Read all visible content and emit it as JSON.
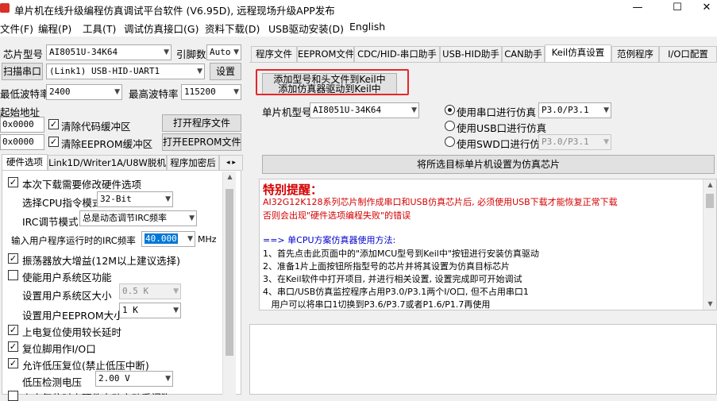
{
  "window": {
    "title": "单片机在线升级编程仿真调试平台软件 (V6.95D), 远程现场升级APP发布",
    "minimize": "—",
    "maximize": "☐",
    "close": "✕"
  },
  "menu": [
    "文件(F)",
    "编程(P)",
    "工具(T)",
    "调试仿真接口(G)",
    "资料下载(D)",
    "USB驱动安装(D)",
    "English"
  ],
  "left": {
    "chip_model_label": "芯片型号",
    "chip_model_value": "AI8051U-34K64",
    "pin_count_label": "引脚数",
    "pin_count_value": "Auto",
    "scan_port_button": "扫描串口",
    "port_value": "(Link1) USB-HID-UART1",
    "settings_button": "设置",
    "min_baud_label": "最低波特率",
    "min_baud_value": "2400",
    "max_baud_label": "最高波特率",
    "max_baud_value": "115200",
    "start_addr_label": "起始地址",
    "addr1_value": "0x0000",
    "clear_code_buffer": "清除代码缓冲区",
    "open_program_button": "打开程序文件",
    "addr2_value": "0x0000",
    "clear_eeprom_buffer": "清除EEPROM缓冲区",
    "open_eeprom_button": "打开EEPROM文件",
    "tabs": [
      "硬件选项",
      "Link1D/Writer1A/U8W脱机",
      "程序加密后"
    ],
    "options": {
      "modify_hw_options": "本次下载需要修改硬件选项",
      "cpu_mode_label": "选择CPU指令模式",
      "cpu_mode_value": "32-Bit",
      "irc_mode_label": "IRC调节模式",
      "irc_mode_value": "总是动态调节IRC频率",
      "irc_freq_label": "输入用户程序运行时的IRC频率",
      "irc_freq_value": "40.000",
      "irc_freq_unit": "MHz",
      "osc_gain": "振荡器放大增益(12M以上建议选择)",
      "user_sys_area": "使能用户系统区功能",
      "user_sys_size_label": "设置用户系统区大小",
      "user_sys_size_value": "0.5 K",
      "user_eeprom_size_label": "设置用户EEPROM大小",
      "user_eeprom_size_value": "1  K",
      "power_on_reset_delay": "上电复位使用较长延时",
      "reset_pin_io": "复位脚用作I/O口",
      "low_voltage_reset": "允许低压复位(禁止低压中断)",
      "low_voltage_label": "低压检测电压",
      "low_voltage_value": "2.00 V",
      "cut_off_text": "上电复位时由硬件自动启动看门狗"
    }
  },
  "right": {
    "tabs": [
      "程序文件",
      "EEPROM文件",
      "CDC/HID-串口助手",
      "USB-HID助手",
      "CAN助手",
      "Keil仿真设置",
      "范例程序",
      "I/O口配置"
    ],
    "add_model_button_line1": "添加型号和头文件到Keil中",
    "add_model_button_line2": "添加仿真器驱动到Keil中",
    "mcu_model_label": "单片机型号",
    "mcu_model_value": "AI8051U-34K64",
    "radio_serial": "使用串口进行仿真",
    "serial_port_value": "P3.0/P3.1",
    "radio_usb": "使用USB口进行仿真",
    "radio_swd": "使用SWD口进行仿真",
    "swd_port_value": "P3.0/P3.1",
    "set_target_button": "将所选目标单片机设置为仿真芯片",
    "notice_title": "特别提醒：",
    "notice_red_1": "AI32G12K128系列芯片制作成串口和USB仿真芯片后, 必须使用USB下载才能恢复正常下载",
    "notice_red_2": "否则会出现\"硬件选项编程失败\"的错误",
    "method_title": "==> 单CPU方案仿真器使用方法:",
    "steps": [
      "1、首先点击此页面中的\"添加MCU型号到Keil中\"按钮进行安装仿真驱动",
      "2、准备1片上面按钮所指型号的芯片并将其设置为仿真目标芯片",
      "3、在Keil软件中打开项目, 并进行相关设置, 设置完成即可开始调试",
      "4、串口/USB仿真监控程序占用P3.0/P3.1两个I/O口, 但不占用串口1",
      "   用户可以将串口1切换到P3.6/P3.7或者P1.6/P1.7再使用"
    ]
  },
  "colors": {
    "highlight_box": "#e8262a",
    "notice_red": "#d40000",
    "method_blue": "#0000cc",
    "selection": "#0078d7"
  }
}
